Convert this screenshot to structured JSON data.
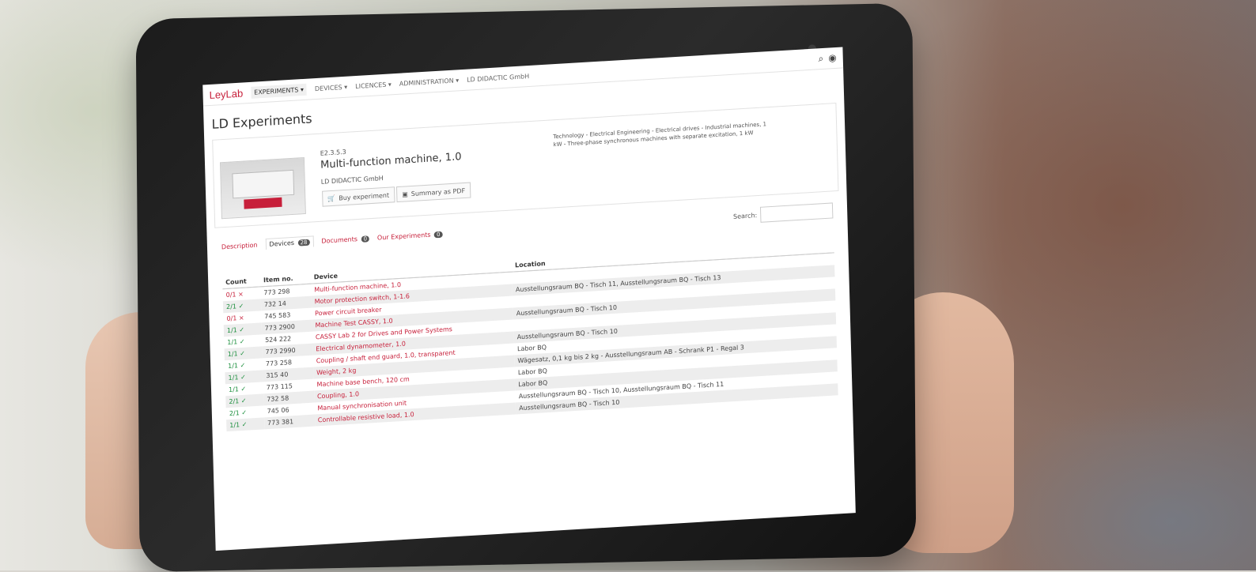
{
  "topbar": {
    "logo": [
      "Ley",
      "Lab"
    ],
    "nav": [
      "EXPERIMENTS ▾",
      "DEVICES ▾",
      "LICENCES ▾",
      "ADMINISTRATION ▾",
      "LD DIDACTIC GmbH"
    ]
  },
  "page_title": "LD Experiments",
  "experiment": {
    "code": "E2.3.5.3",
    "title": "Multi-function machine, 1.0",
    "company": "LD DIDACTIC GmbH",
    "buy_label": "Buy experiment",
    "pdf_label": "Summary as PDF",
    "breadcrumb": "Technology - Electrical Engineering - Electrical drives - Industrial machines, 1 kW - Three-phase synchronous machines with separate excitation, 1 kW"
  },
  "tabs": [
    {
      "label": "Description"
    },
    {
      "label": "Devices",
      "badge": "28"
    },
    {
      "label": "Documents",
      "badge": "0"
    },
    {
      "label": "Our Experiments",
      "badge": "0"
    }
  ],
  "search_label": "Search:",
  "table": {
    "headers": [
      "Count",
      "Item no.",
      "Device",
      "Location"
    ],
    "rows": [
      {
        "count": "0/1 ×",
        "status": "x",
        "item": "773 298",
        "device": "Multi-function machine, 1.0",
        "location": ""
      },
      {
        "count": "2/1 ✓",
        "status": "ok",
        "item": "732 14",
        "device": "Motor protection switch, 1-1.6",
        "location": "Ausstellungsraum BQ - Tisch 11, Ausstellungsraum BQ - Tisch 13"
      },
      {
        "count": "0/1 ×",
        "status": "x",
        "item": "745 583",
        "device": "Power circuit breaker",
        "location": ""
      },
      {
        "count": "1/1 ✓",
        "status": "ok",
        "item": "773 2900",
        "device": "Machine Test CASSY, 1.0",
        "location": "Ausstellungsraum BQ - Tisch 10"
      },
      {
        "count": "1/1 ✓",
        "status": "ok",
        "item": "524 222",
        "device": "CASSY Lab 2 for Drives and Power Systems",
        "location": ""
      },
      {
        "count": "1/1 ✓",
        "status": "ok",
        "item": "773 2990",
        "device": "Electrical dynamometer, 1.0",
        "location": "Ausstellungsraum BQ - Tisch 10"
      },
      {
        "count": "1/1 ✓",
        "status": "ok",
        "item": "773 258",
        "device": "Coupling / shaft end guard, 1.0, transparent",
        "location": "Labor BQ"
      },
      {
        "count": "1/1 ✓",
        "status": "ok",
        "item": "315 40",
        "device": "Weight, 2 kg",
        "location": "Wägesatz, 0,1 kg bis 2 kg - Ausstellungsraum AB - Schrank P1 - Regal 3"
      },
      {
        "count": "1/1 ✓",
        "status": "ok",
        "item": "773 115",
        "device": "Machine base bench, 120 cm",
        "location": "Labor BQ"
      },
      {
        "count": "2/1 ✓",
        "status": "ok",
        "item": "732 58",
        "device": "Coupling, 1.0",
        "location": "Labor BQ"
      },
      {
        "count": "2/1 ✓",
        "status": "ok",
        "item": "745 06",
        "device": "Manual synchronisation unit",
        "location": "Ausstellungsraum BQ - Tisch 10, Ausstellungsraum BQ - Tisch 11"
      },
      {
        "count": "1/1 ✓",
        "status": "ok",
        "item": "773 381",
        "device": "Controllable resistive load, 1.0",
        "location": "Ausstellungsraum BQ - Tisch 10"
      }
    ]
  }
}
